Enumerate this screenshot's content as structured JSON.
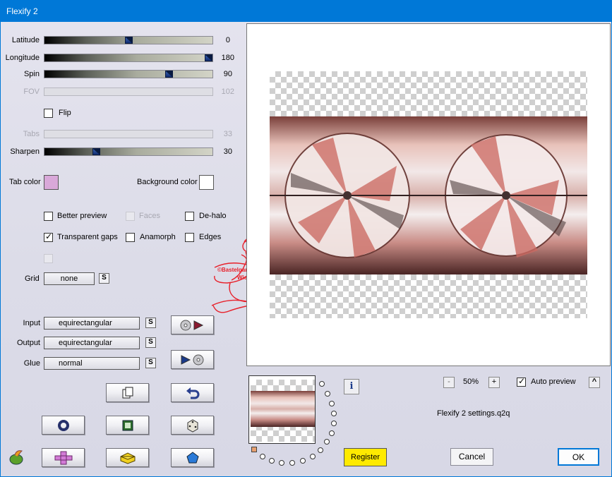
{
  "window": {
    "title": "Flexify 2"
  },
  "sliders": {
    "latitude": {
      "label": "Latitude",
      "value": "0",
      "fraction": 0.5
    },
    "longitude": {
      "label": "Longitude",
      "value": "180",
      "fraction": 1.0
    },
    "spin": {
      "label": "Spin",
      "value": "90",
      "fraction": 0.75
    },
    "fov": {
      "label": "FOV",
      "value": "102",
      "enabled": false
    },
    "tabs": {
      "label": "Tabs",
      "value": "33",
      "enabled": false
    },
    "sharpen": {
      "label": "Sharpen",
      "value": "30",
      "fraction": 0.3
    }
  },
  "flip": {
    "label": "Flip",
    "checked": false
  },
  "colors": {
    "tab_color_label": "Tab color",
    "tab_color": "#d9a8d9",
    "background_color_label": "Background color",
    "background_color": "#ffffff"
  },
  "options": {
    "better_preview": {
      "label": "Better preview",
      "checked": false
    },
    "faces": {
      "label": "Faces",
      "checked": false,
      "enabled": false
    },
    "de_halo": {
      "label": "De-halo",
      "checked": false
    },
    "transparent_gaps": {
      "label": "Transparent gaps",
      "checked": true
    },
    "anamorph": {
      "label": "Anamorph",
      "checked": false
    },
    "edges": {
      "label": "Edges",
      "checked": false
    }
  },
  "grid": {
    "label": "Grid",
    "value": "none",
    "s": "S"
  },
  "projection": {
    "input_label": "Input",
    "input_value": "equirectangular",
    "output_label": "Output",
    "output_value": "equirectangular",
    "glue_label": "Glue",
    "glue_value": "normal",
    "s": "S"
  },
  "watermark": {
    "line1": "©Bastelgarten",
    "line2": "Wien"
  },
  "zoom": {
    "minus": "-",
    "value": "50%",
    "plus": "+"
  },
  "auto_preview": {
    "label": "Auto preview",
    "checked": true,
    "caret": "^"
  },
  "settings_file": "Flexify 2 settings.q2q",
  "info_label": "i",
  "buttons": {
    "register": "Register",
    "cancel": "Cancel",
    "ok": "OK"
  }
}
